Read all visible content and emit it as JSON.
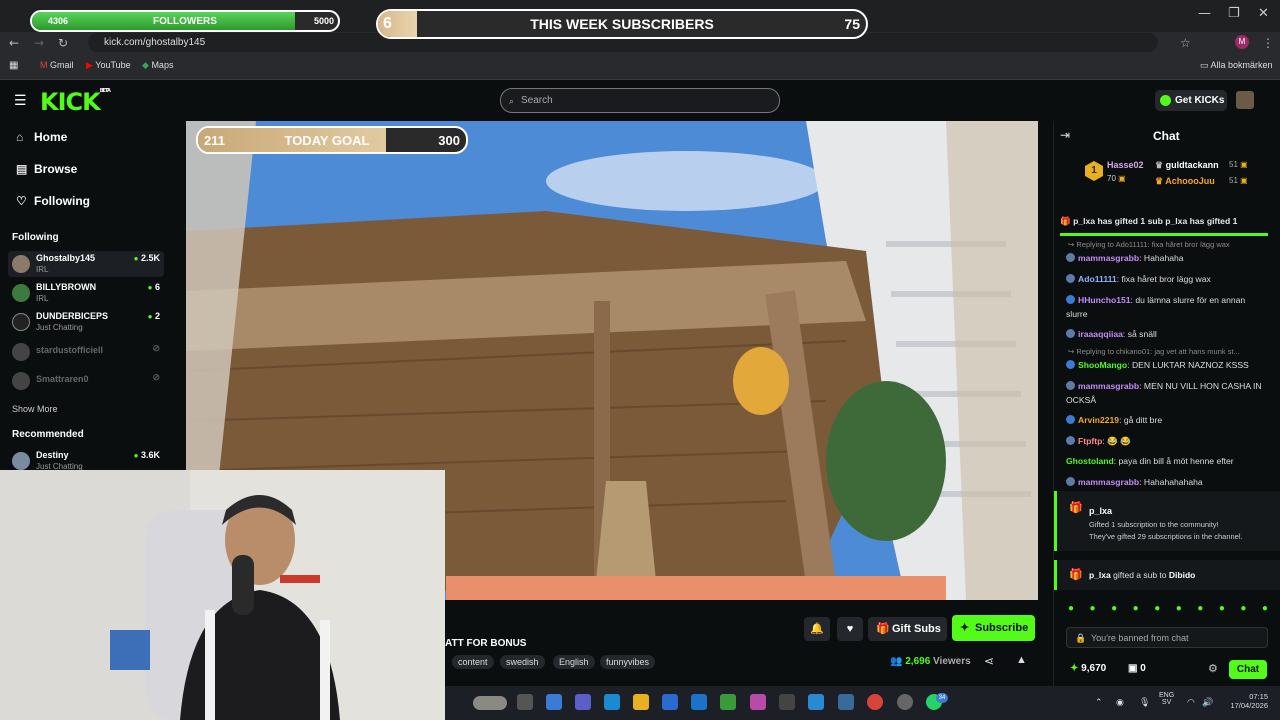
{
  "browser": {
    "url": "kick.com/ghostalby145",
    "bookmarks": [
      "Gmail",
      "YouTube",
      "Maps"
    ],
    "all_bookmarks": "Alla bokmärken",
    "profile_initial": "M"
  },
  "overlays": {
    "followers": {
      "current": "4306",
      "label": "FOLLOWERS",
      "goal": "5000",
      "progress": 0.86
    },
    "subscribers": {
      "current": "6",
      "label": "THIS WEEK SUBSCRIBERS",
      "goal": "75",
      "progress": 0.08
    },
    "today_goal": {
      "current": "211",
      "label": "TODAY GOAL",
      "goal": "300",
      "progress": 0.7
    }
  },
  "header": {
    "logo": "KICK",
    "logo_sup": "BETA",
    "search_placeholder": "Search",
    "get_kicks": "Get KICKs"
  },
  "sidebar": {
    "nav": [
      {
        "label": "Home"
      },
      {
        "label": "Browse"
      },
      {
        "label": "Following"
      }
    ],
    "following_heading": "Following",
    "following": [
      {
        "name": "Ghostalby145",
        "category": "IRL",
        "viewers": "2.5K"
      },
      {
        "name": "BILLYBROWN",
        "category": "IRL",
        "viewers": "6"
      },
      {
        "name": "DUNDERBICEPS",
        "category": "Just Chatting",
        "viewers": "2"
      },
      {
        "name": "stardustofficiell"
      },
      {
        "name": "Smattraren0"
      }
    ],
    "show_more": "Show More",
    "recommended_heading": "Recommended",
    "recommended": [
      {
        "name": "Destiny",
        "category": "Just Chatting",
        "viewers": "3.6K"
      }
    ]
  },
  "stream": {
    "title_fragment": "ATT FOR BONUS",
    "tags": [
      "content",
      "swedish",
      "English",
      "funnyvibes"
    ],
    "gift_subs": "Gift Subs",
    "subscribe": "Subscribe",
    "viewers_count": "2,696",
    "viewers_label": "Viewers"
  },
  "chat": {
    "title": "Chat",
    "leaderboard": [
      {
        "rank": "1",
        "name": "Hasse02",
        "value": "70"
      },
      {
        "name": "guldtackann",
        "value": "51"
      },
      {
        "name": "AchoooJuu",
        "value": "51"
      }
    ],
    "top_line": "p_lxa has gifted 1 sub   p_lxa has gifted 1",
    "messages": [
      {
        "reply": "Replying to Ado11111: fixa håret bror lägg wax",
        "user": "mammasgrabb",
        "color": "#c58af9",
        "text": "Hahahaha"
      },
      {
        "user": "Ado11111",
        "color": "#8fb4ff",
        "text": "fixa håret bror lägg wax"
      },
      {
        "user": "HHuncho151",
        "color": "#c58af9",
        "text": "du lämna slurre för en annan slurre"
      },
      {
        "user": "iraaaqqiiaa",
        "color": "#c58af9",
        "text": "så snäll"
      },
      {
        "reply": "Replying to chikano01: jag vet att hans munk st...",
        "user": "ShooMango",
        "color": "#53fc18",
        "text": "DEN LUKTAR NAZNOZ KSSS"
      },
      {
        "user": "mammasgrabb",
        "color": "#c58af9",
        "text": "MEN NU VILL HON CASHA IN OCKSÅ"
      },
      {
        "user": "Arvin2219",
        "color": "#f5a623",
        "text": "gå ditt bre"
      },
      {
        "user": "Ftpftp",
        "color": "#ff8a8a",
        "text": "😂 😂"
      },
      {
        "user": "Ghostoland",
        "color": "#53fc18",
        "text": "paya din bill å möt henne efter"
      },
      {
        "user": "mammasgrabb",
        "color": "#c58af9",
        "text": "Hahahahahaha"
      }
    ],
    "gift_event": {
      "user": "p_lxa",
      "line1": "Gifted 1 subscription to the community!",
      "line2": "They've gifted 29 subscriptions in the channel."
    },
    "gift_event2": {
      "user": "p_lxa",
      "text": "gifted a sub to",
      "target": "Dibido"
    },
    "banned": "You're banned from chat",
    "kicks": "9,670",
    "points": "0",
    "chat_button": "Chat"
  },
  "taskbar": {
    "lang1": "ENG",
    "lang2": "SV",
    "time": "07:15",
    "date": "17/04/2026",
    "whatsapp_badge": "34"
  }
}
